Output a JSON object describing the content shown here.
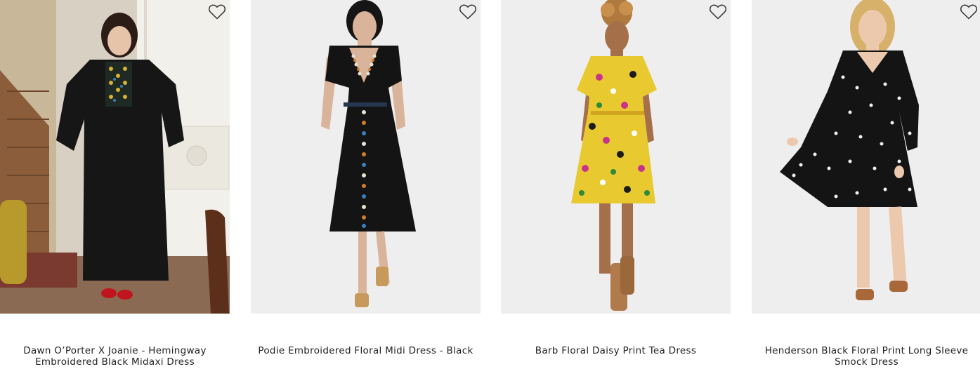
{
  "products": [
    {
      "name": "Dawn O’Porter X Joanie - Hemingway Embroidered Black Midaxi Dress",
      "image_alt": "Dawn O’Porter X Joanie - Hemingway Embroidered Black Midaxi Dress",
      "wishlist_icon": "heart-outline-icon"
    },
    {
      "name": "Podie Embroidered Floral Midi Dress - Black",
      "image_alt": "Podie Embroidered Floral Midi Dress - Black",
      "wishlist_icon": "heart-outline-icon"
    },
    {
      "name": "Barb Floral Daisy Print Tea Dress",
      "image_alt": "Barb Floral Daisy Print Tea Dress",
      "wishlist_icon": "heart-outline-icon"
    },
    {
      "name": "Henderson Black Floral Print Long Sleeve Smock Dress",
      "image_alt": "Henderson Black Floral Print Long Sleeve Smock Dress",
      "wishlist_icon": "heart-outline-icon"
    }
  ],
  "colors": {
    "title_text": "#222222",
    "studio_background": "#eeeeef",
    "heart_stroke": "#333333"
  }
}
